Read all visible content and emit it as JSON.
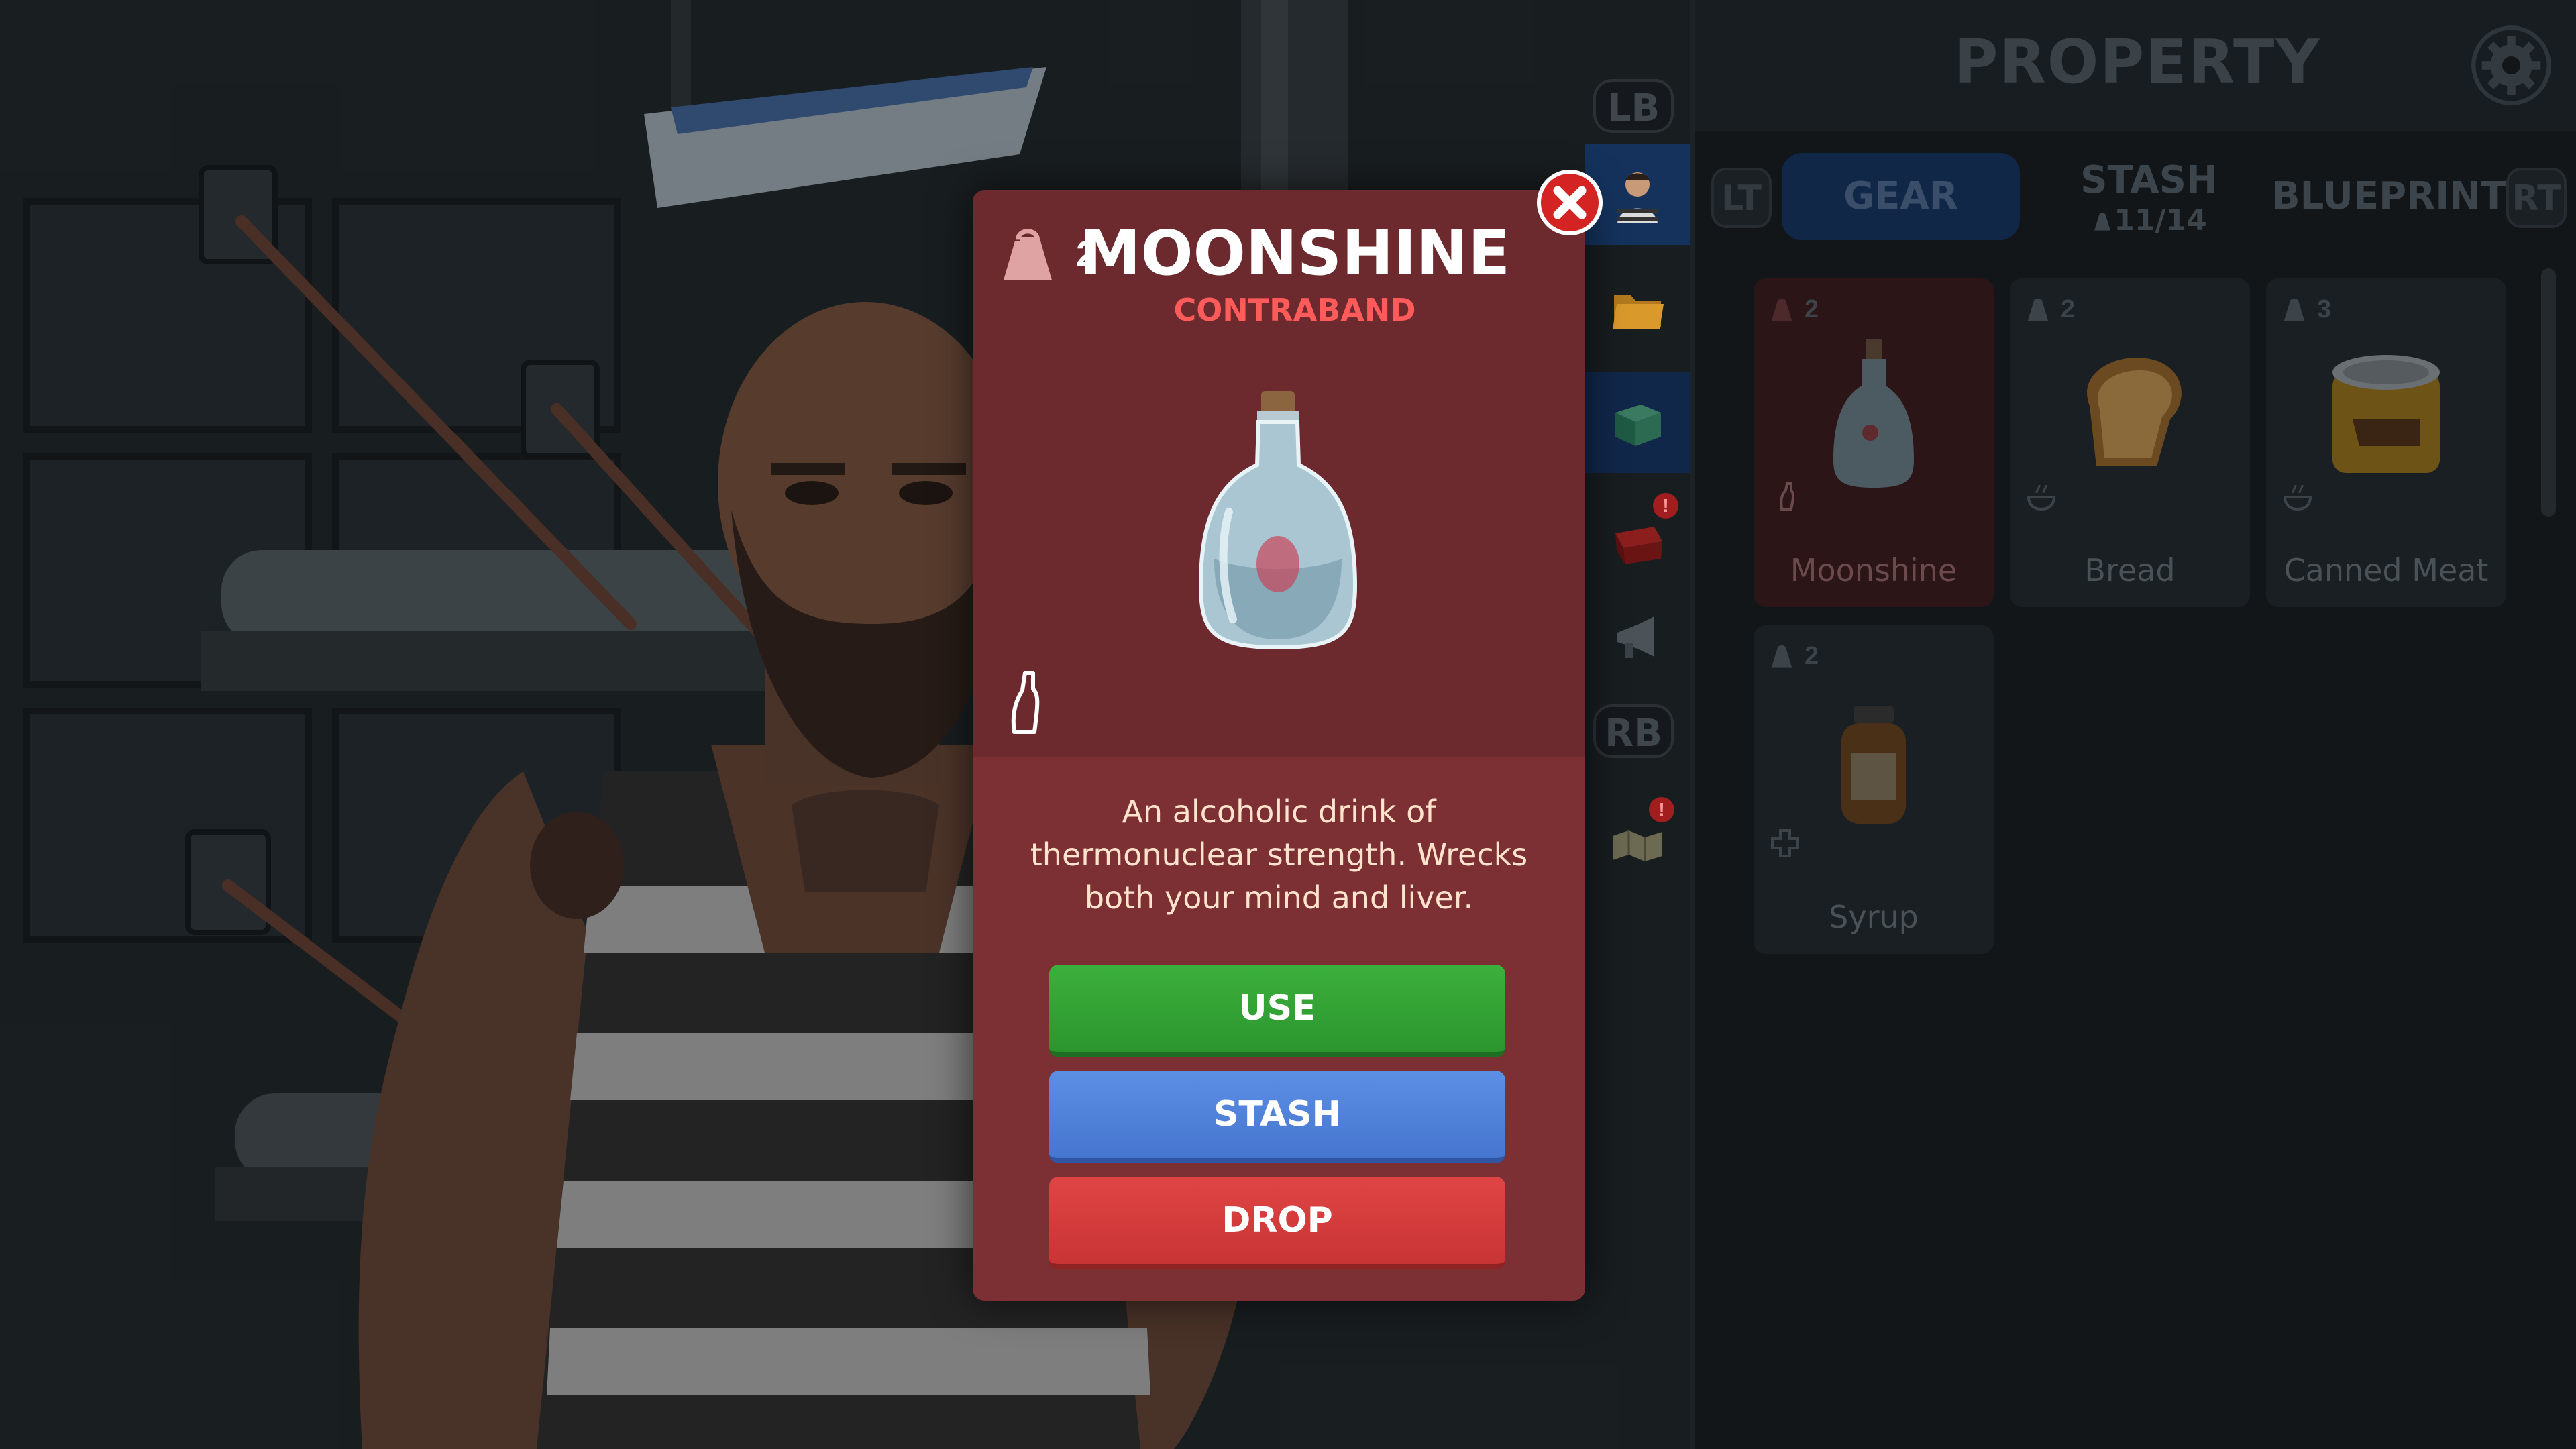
{
  "panel": {
    "title": "PROPERTY",
    "settings_icon": "gear-icon",
    "trigger_left": "LT",
    "trigger_right": "RT",
    "tabs": [
      {
        "label": "GEAR",
        "active": true
      },
      {
        "label": "STASH",
        "sub": "11/14",
        "active": false
      },
      {
        "label": "BLUEPRINTS",
        "active": false
      }
    ],
    "items": [
      {
        "name": "Moonshine",
        "weight": "2",
        "icon": "bottle-icon",
        "category_icon": "bottle-icon",
        "selected": true
      },
      {
        "name": "Bread",
        "weight": "2",
        "icon": "bread-icon",
        "category_icon": "food-bowl-icon",
        "selected": false
      },
      {
        "name": "Canned Meat",
        "weight": "3",
        "icon": "canned-meat-icon",
        "category_icon": "food-bowl-icon",
        "selected": false
      },
      {
        "name": "Syrup",
        "weight": "2",
        "icon": "syrup-jar-icon",
        "category_icon": "medical-cross-icon",
        "selected": false
      }
    ]
  },
  "side_tabs": {
    "lb": "LB",
    "rb": "RB",
    "items": [
      {
        "icon": "prisoner-avatar-icon",
        "active": true
      },
      {
        "icon": "folder-icon"
      },
      {
        "icon": "safe-icon"
      },
      {
        "icon": "treasure-chest-icon",
        "alert": "!"
      },
      {
        "icon": "megaphone-icon"
      },
      {
        "icon": "map-icon",
        "alert": "!"
      }
    ]
  },
  "modal": {
    "weight": "2",
    "title": "MOONSHINE",
    "subtitle": "CONTRABAND",
    "description": "An alcoholic drink of thermonuclear strength. Wrecks both your mind and liver.",
    "buttons": {
      "use": "USE",
      "stash": "STASH",
      "drop": "DROP"
    },
    "colors": {
      "use": "#3cb03c",
      "stash": "#5b8fe4",
      "drop": "#e04545",
      "subtitle": "#ff5b5b"
    }
  }
}
